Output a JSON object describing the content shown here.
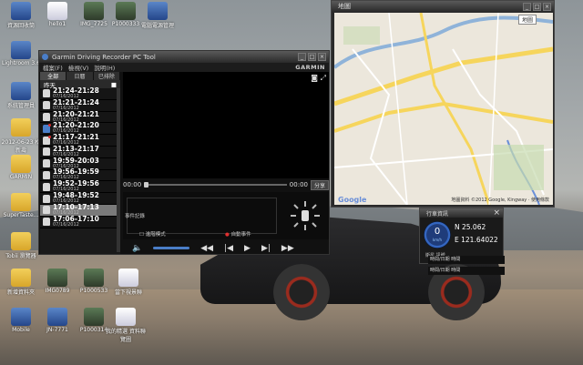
{
  "desktop_icons": [
    {
      "label": "資源回收筒",
      "kind": "app"
    },
    {
      "label": "hello1",
      "kind": "file"
    },
    {
      "label": "IMG_7725",
      "kind": "img"
    },
    {
      "label": "P1000333",
      "kind": "img"
    },
    {
      "label": "電腦電源管理",
      "kind": "app"
    },
    {
      "label": "Lightroom 3.6",
      "kind": "app"
    },
    {
      "label": "系統管理員",
      "kind": "app"
    },
    {
      "label": "2012-06-23 松新壽",
      "kind": "folder"
    },
    {
      "label": "GARMIN",
      "kind": "folder"
    },
    {
      "label": "SuperTaste...",
      "kind": "folder"
    },
    {
      "label": "Tobii 瀏覽器",
      "kind": "folder"
    },
    {
      "label": "新增資料夾",
      "kind": "folder"
    },
    {
      "label": "IMG0789",
      "kind": "img"
    },
    {
      "label": "P1000533",
      "kind": "img"
    },
    {
      "label": "當下視景聯",
      "kind": "file"
    },
    {
      "label": "Mobile",
      "kind": "app"
    },
    {
      "label": "JN-7771",
      "kind": "app"
    },
    {
      "label": "P1000314",
      "kind": "img"
    },
    {
      "label": "我的精選 資料聯覽圖",
      "kind": "file"
    }
  ],
  "main_window": {
    "title": "Garmin Driving Recorder PC Tool",
    "menu": [
      "檔案(F)",
      "檢視(V)",
      "說明(H)"
    ],
    "brand": "GARMIN",
    "tabs": [
      "全部",
      "日曆",
      "已排除"
    ],
    "day": "昨天",
    "clips": [
      {
        "time": "21:24-21:28",
        "date": "07/16/2012",
        "lock": "white",
        "event": false
      },
      {
        "time": "21:21-21:24",
        "date": "07/16/2012",
        "lock": "white",
        "event": false
      },
      {
        "time": "21:20-21:21",
        "date": "07/16/2012",
        "lock": "white",
        "event": false
      },
      {
        "time": "21:20-21:20",
        "date": "07/16/2012",
        "lock": "blue",
        "event": true
      },
      {
        "time": "21:17-21:21",
        "date": "07/16/2012",
        "lock": "white",
        "event": true
      },
      {
        "time": "21:13-21:17",
        "date": "07/16/2012",
        "lock": "white",
        "event": false
      },
      {
        "time": "19:59-20:03",
        "date": "07/16/2012",
        "lock": "white",
        "event": false
      },
      {
        "time": "19:56-19:59",
        "date": "07/16/2012",
        "lock": "white",
        "event": false
      },
      {
        "time": "19:52-19:56",
        "date": "07/16/2012",
        "lock": "white",
        "event": false
      },
      {
        "time": "19:48-19:52",
        "date": "07/16/2012",
        "lock": "white",
        "event": false
      },
      {
        "time": "17:10-17:13",
        "date": "07/16/2012",
        "lock": "white",
        "event": false,
        "selected": true
      },
      {
        "time": "17:06-17:10",
        "date": "07/16/2012",
        "lock": "white",
        "event": false
      }
    ],
    "time_start": "00:00",
    "time_end": "00:00",
    "share_label": "分享",
    "event_label": "事件記錄",
    "check_label_1": "進階模式",
    "check_label_2": "自動事件"
  },
  "map_window": {
    "title": "地圖",
    "map_type": "地圖",
    "logo": "Google",
    "copyright": "地圖資料 ©2012 Google, Kingway · 使用條款"
  },
  "gps_panel": {
    "title": "行車資訊",
    "speed": "0",
    "unit": "km/h",
    "lat": "N 25.062",
    "lon": "E 121.64022",
    "mode": "衛星 訊號",
    "info": [
      "時間/日期 時間",
      "時間/日期 時間"
    ]
  }
}
